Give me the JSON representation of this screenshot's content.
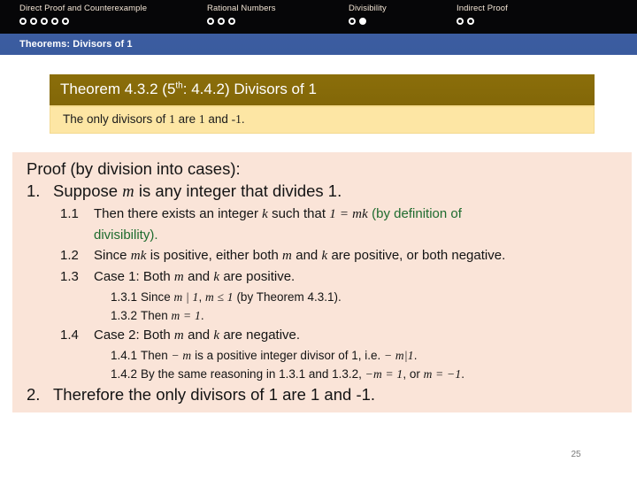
{
  "topnav": {
    "groups": [
      {
        "label": "Direct Proof and Counterexample",
        "dots": [
          "hollow",
          "hollow",
          "hollow",
          "hollow",
          "hollow"
        ]
      },
      {
        "label": "Rational Numbers",
        "dots": [
          "hollow",
          "hollow",
          "hollow"
        ]
      },
      {
        "label": "Divisibility",
        "dots": [
          "hollow",
          "filled"
        ]
      },
      {
        "label": "Indirect Proof",
        "dots": [
          "hollow",
          "hollow"
        ]
      }
    ],
    "background_color": "#060608",
    "label_color": "#f2e4d4"
  },
  "titlebar": {
    "title": "Theorems: Divisors of 1",
    "background_color": "#3b5ca0",
    "text_color": "#ffffff"
  },
  "theorem": {
    "header_prefix": "Theorem 4.3.2 (5",
    "header_sup": "th",
    "header_suffix": ": 4.4.2) Divisors of 1",
    "header_bg": "#8a6d09",
    "statement_bg": "#fde6a4",
    "statement": {
      "t1": "The only divisors of ",
      "n1": "1",
      "t2": " are ",
      "n2": "1",
      "t3": " and ",
      "n3": "-1",
      "t4": "."
    }
  },
  "proof": {
    "background_color": "#fae4d8",
    "heading": "Proof (by division into cases):",
    "step1": {
      "num": "1.",
      "a": "Suppose ",
      "m": "m",
      "b": " is any integer that divides 1."
    },
    "step1_1": {
      "num": "1.1",
      "a": "Then there exists an integer ",
      "k": "k",
      "b": " such that ",
      "eq": "1 = mk",
      "green1": " (by definition of",
      "green2": "divisibility)."
    },
    "step1_2": {
      "num": "1.2",
      "a": "Since ",
      "mk": "mk",
      "b": " is positive, either both ",
      "m": "m",
      "c": " and ",
      "k": "k",
      "d": " are positive, or both negative."
    },
    "step1_3": {
      "num": "1.3",
      "a": "Case 1: Both ",
      "m": "m",
      "b": " and ",
      "k": "k",
      "c": " are positive."
    },
    "step1_3_1": {
      "num": "1.3.1",
      "a": "Since ",
      "expr1": "m | 1",
      "b": ", ",
      "expr2": "m ≤ 1",
      "c": " (by Theorem 4.3.1)."
    },
    "step1_3_2": {
      "num": "1.3.2",
      "a": "Then ",
      "expr": "m = 1",
      "b": "."
    },
    "step1_4": {
      "num": "1.4",
      "a": "Case 2: Both ",
      "m": "m",
      "b": " and ",
      "k": "k",
      "c": " are negative."
    },
    "step1_4_1": {
      "num": "1.4.1",
      "a": "Then ",
      "expr1": "− m",
      "b": " is a positive integer divisor of 1, i.e. ",
      "expr2": "− m|1",
      "c": "."
    },
    "step1_4_2": {
      "num": "1.4.2",
      "a": "By the same reasoning in 1.3.1 and 1.3.2, ",
      "expr1": "−m = 1",
      "b": ", or ",
      "expr2": "m = −1",
      "c": "."
    },
    "step2": {
      "num": "2.",
      "a": "Therefore the only divisors of 1 are 1 and -1."
    }
  },
  "page_number": "25"
}
